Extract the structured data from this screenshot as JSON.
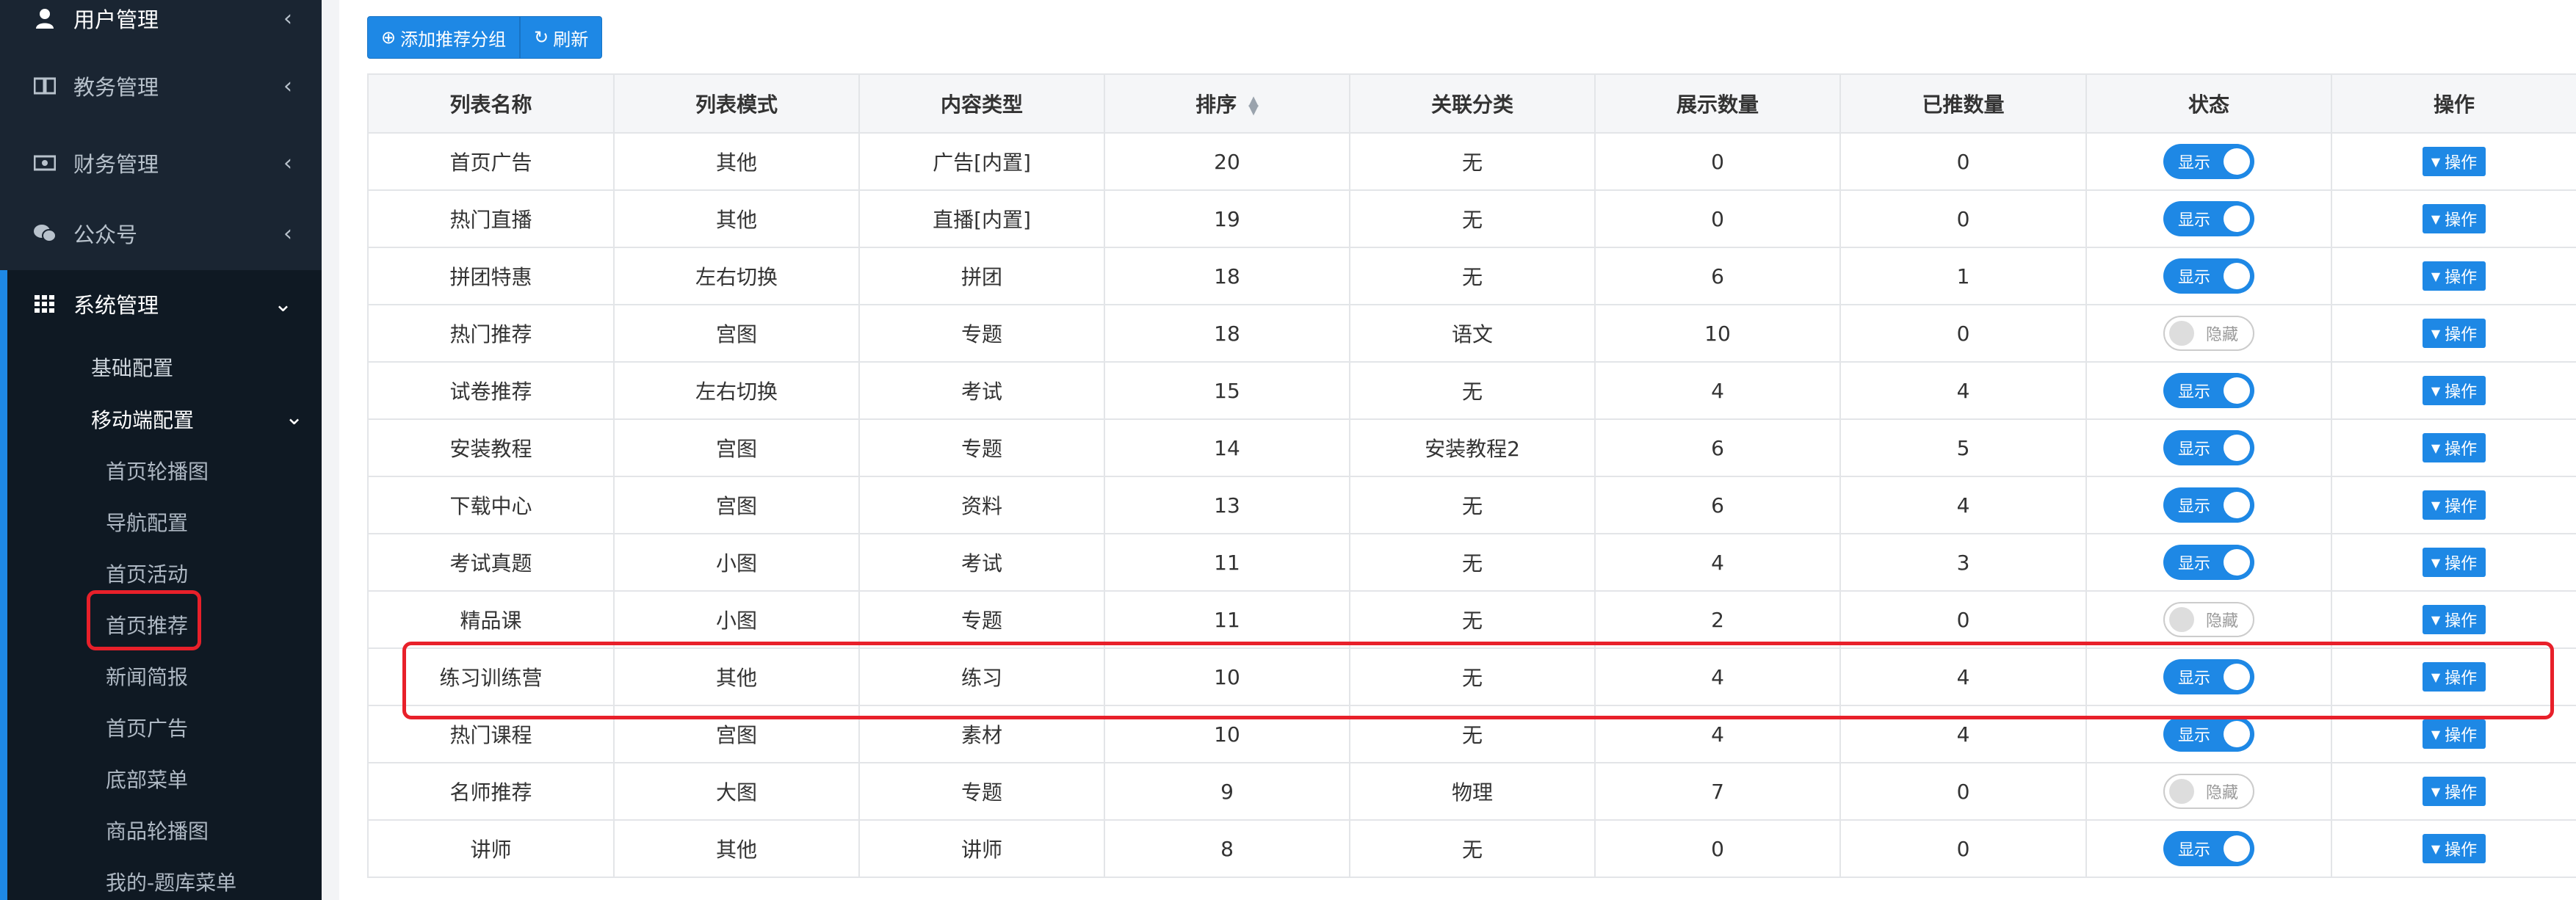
{
  "sidebar": {
    "items": [
      {
        "label": "用户管理",
        "icon": "user-icon"
      },
      {
        "label": "教务管理",
        "icon": "book-icon"
      },
      {
        "label": "财务管理",
        "icon": "money-icon"
      },
      {
        "label": "公众号",
        "icon": "wechat-icon"
      },
      {
        "label": "系统管理",
        "icon": "grid-icon"
      }
    ],
    "sub": {
      "basic": "基础配置",
      "mobile": "移动端配置",
      "mobile_items": [
        "首页轮播图",
        "导航配置",
        "首页活动",
        "首页推荐",
        "新闻简报",
        "首页广告",
        "底部菜单",
        "商品轮播图",
        "我的-题库菜单"
      ]
    }
  },
  "toolbar": {
    "add_label": "添加推荐分组",
    "refresh_label": "刷新"
  },
  "table": {
    "headers": [
      "列表名称",
      "列表模式",
      "内容类型",
      "排序",
      "关联分类",
      "展示数量",
      "已推数量",
      "状态",
      "操作"
    ],
    "status_on": "显示",
    "status_off": "隐藏",
    "op_label": "操作",
    "rows": [
      {
        "name": "首页广告",
        "mode": "其他",
        "type": "广告[内置]",
        "sort": "20",
        "cat": "无",
        "show": "0",
        "pushed": "0",
        "on": true
      },
      {
        "name": "热门直播",
        "mode": "其他",
        "type": "直播[内置]",
        "sort": "19",
        "cat": "无",
        "show": "0",
        "pushed": "0",
        "on": true
      },
      {
        "name": "拼团特惠",
        "mode": "左右切换",
        "type": "拼团",
        "sort": "18",
        "cat": "无",
        "show": "6",
        "pushed": "1",
        "on": true
      },
      {
        "name": "热门推荐",
        "mode": "宫图",
        "type": "专题",
        "sort": "18",
        "cat": "语文",
        "show": "10",
        "pushed": "0",
        "on": false
      },
      {
        "name": "试卷推荐",
        "mode": "左右切换",
        "type": "考试",
        "sort": "15",
        "cat": "无",
        "show": "4",
        "pushed": "4",
        "on": true
      },
      {
        "name": "安装教程",
        "mode": "宫图",
        "type": "专题",
        "sort": "14",
        "cat": "安装教程2",
        "show": "6",
        "pushed": "5",
        "on": true
      },
      {
        "name": "下载中心",
        "mode": "宫图",
        "type": "资料",
        "sort": "13",
        "cat": "无",
        "show": "6",
        "pushed": "4",
        "on": true
      },
      {
        "name": "考试真题",
        "mode": "小图",
        "type": "考试",
        "sort": "11",
        "cat": "无",
        "show": "4",
        "pushed": "3",
        "on": true
      },
      {
        "name": "精品课",
        "mode": "小图",
        "type": "专题",
        "sort": "11",
        "cat": "无",
        "show": "2",
        "pushed": "0",
        "on": false
      },
      {
        "name": "练习训练营",
        "mode": "其他",
        "type": "练习",
        "sort": "10",
        "cat": "无",
        "show": "4",
        "pushed": "4",
        "on": true
      },
      {
        "name": "热门课程",
        "mode": "宫图",
        "type": "素材",
        "sort": "10",
        "cat": "无",
        "show": "4",
        "pushed": "4",
        "on": true
      },
      {
        "name": "名师推荐",
        "mode": "大图",
        "type": "专题",
        "sort": "9",
        "cat": "物理",
        "show": "7",
        "pushed": "0",
        "on": false
      },
      {
        "name": "讲师",
        "mode": "其他",
        "type": "讲师",
        "sort": "8",
        "cat": "无",
        "show": "0",
        "pushed": "0",
        "on": true
      }
    ]
  },
  "colors": {
    "sidebar_bg": "#1a2532",
    "accent": "#1e88e5",
    "highlight": "#e8202a"
  }
}
